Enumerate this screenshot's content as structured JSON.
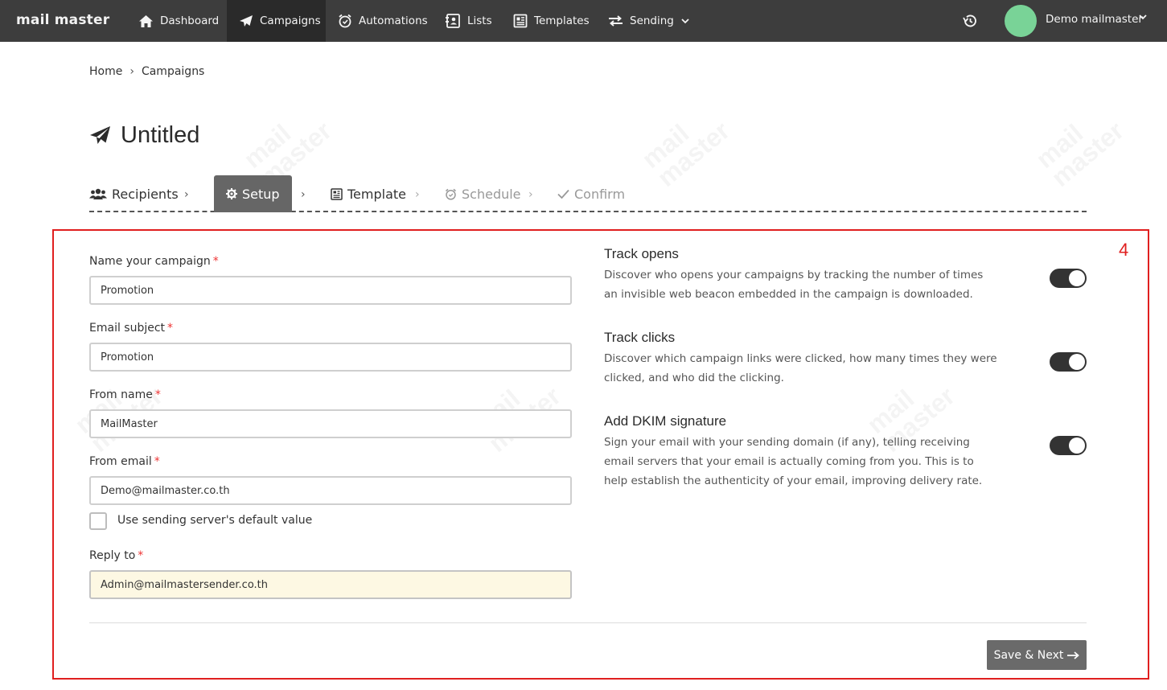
{
  "app": {
    "logo": "mail master"
  },
  "nav": {
    "items": [
      {
        "label": "Dashboard"
      },
      {
        "label": "Campaigns"
      },
      {
        "label": "Automations"
      },
      {
        "label": "Lists"
      },
      {
        "label": "Templates"
      },
      {
        "label": "Sending"
      }
    ],
    "user_name": "Demo mailmaster"
  },
  "breadcrumb": {
    "home": "Home",
    "sep": "›",
    "current": "Campaigns"
  },
  "page": {
    "title": "Untitled"
  },
  "steps": [
    {
      "label": "Recipients",
      "state": "done"
    },
    {
      "label": "Setup",
      "state": "active"
    },
    {
      "label": "Template",
      "state": "pending"
    },
    {
      "label": "Schedule",
      "state": "disabled"
    },
    {
      "label": "Confirm",
      "state": "disabled"
    }
  ],
  "annotation": {
    "number": "4",
    "color": "#e01f1f"
  },
  "form": {
    "campaign_name": {
      "label": "Name your campaign",
      "value": "Promotion"
    },
    "email_subject": {
      "label": "Email subject",
      "value": "Promotion"
    },
    "from_name": {
      "label": "From name",
      "value": "MailMaster"
    },
    "from_email": {
      "label": "From email",
      "value": "Demo@mailmaster.co.th"
    },
    "default_value_checkbox": {
      "label": "Use sending server's default value",
      "checked": false
    },
    "reply_to": {
      "label": "Reply to",
      "value": "Admin@mailmastersender.co.th"
    },
    "required_mark": "*"
  },
  "options": {
    "track_opens": {
      "title": "Track opens",
      "description": "Discover who opens your campaigns by tracking the number of times an invisible web beacon embedded in the campaign is downloaded.",
      "enabled": true
    },
    "track_clicks": {
      "title": "Track clicks",
      "description": "Discover which campaign links were clicked, how many times they were clicked, and who did the clicking.",
      "enabled": true
    },
    "dkim": {
      "title": "Add DKIM signature",
      "description": "Sign your email with your sending domain (if any), telling receiving email servers that your email is actually coming from you. This is to help establish the authenticity of your email, improving delivery rate.",
      "enabled": true
    }
  },
  "actions": {
    "save_next": "Save & Next"
  },
  "colors": {
    "topbar": "#3d3d3d",
    "active_nav": "#2a2a2a",
    "avatar": "#79d397",
    "required": "#e33333",
    "reply_highlight": "#fdf8e3"
  }
}
